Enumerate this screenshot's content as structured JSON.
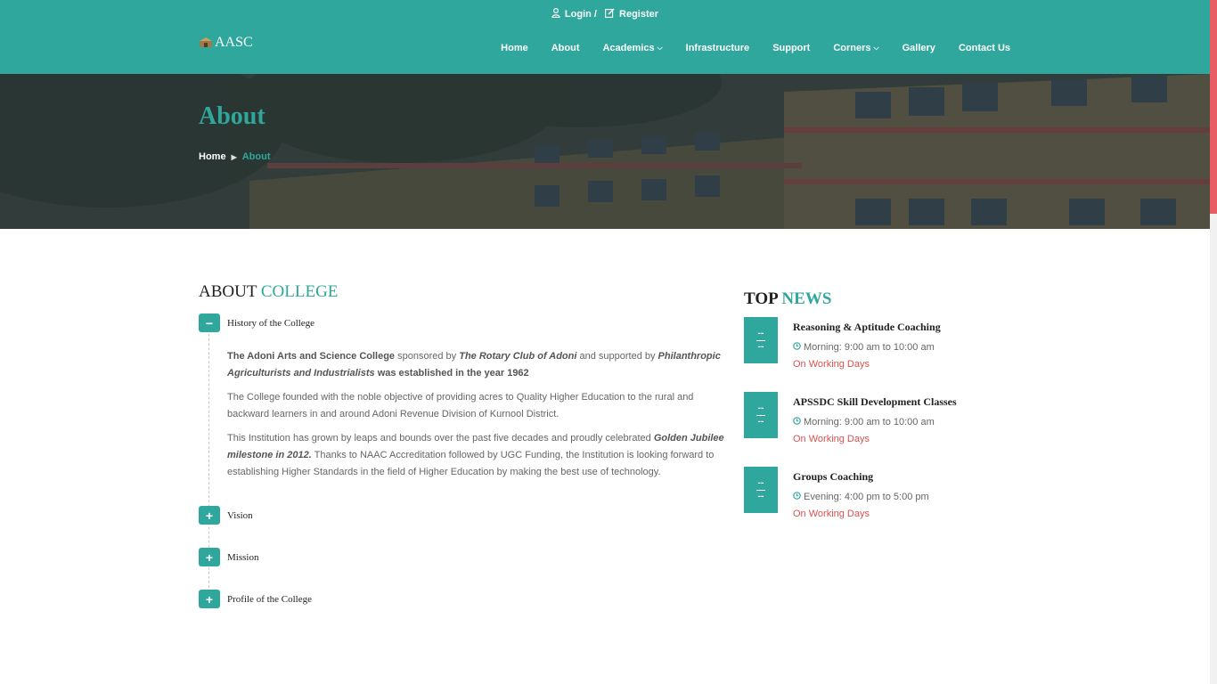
{
  "colors": {
    "brand": "#2fa79c",
    "accent_red": "#d9534f",
    "scroll_thumb": "#e85d64"
  },
  "topbar": {
    "login": "Login /",
    "register": "Register"
  },
  "logo": {
    "text": "AASC"
  },
  "nav": {
    "items": [
      {
        "label": "Home"
      },
      {
        "label": "About"
      },
      {
        "label": "Academics",
        "caret": "chevron-down-icon"
      },
      {
        "label": "Infrastructure"
      },
      {
        "label": "Support"
      },
      {
        "label": "Corners",
        "caret": "chevron-down-icon"
      },
      {
        "label": "Gallery"
      },
      {
        "label": "Contact Us"
      }
    ]
  },
  "banner": {
    "title": "About",
    "breadcrumb_home": "Home",
    "breadcrumb_current": "About"
  },
  "about": {
    "title_plain": "ABOUT",
    "title_accent": "COLLEGE",
    "accordion": [
      {
        "label": "History of the College",
        "state": "expanded",
        "toggle": "−"
      },
      {
        "label": "Vision",
        "state": "collapsed",
        "toggle": "+"
      },
      {
        "label": "Mission",
        "state": "collapsed",
        "toggle": "+"
      },
      {
        "label": "Profile of the College",
        "state": "collapsed",
        "toggle": "+"
      }
    ],
    "history": {
      "p1_a": "The Adoni Arts and Science College",
      "p1_b": " sponsored by ",
      "p1_c": "The Rotary Club of Adoni",
      "p1_d": " and supported by ",
      "p1_e": "Philanthropic Agriculturists and Industrialists",
      "p1_f": " was established in the year 1962",
      "p2": "The College founded with the noble objective of providing acres to Quality Higher Education to the rural and backward learners in and around Adoni Revenue Division of Kurnool District.",
      "p3_a": "This Institution has grown by leaps and bounds over the past five decades and proudly celebrated ",
      "p3_b": "Golden Jubilee milestone in 2012.",
      "p3_c": " Thanks to NAAC Accreditation followed by UGC Funding, the Institution is looking forward to establishing Higher Standards in the field of Higher Education by making the best use of technology."
    }
  },
  "news": {
    "title_plain": "TOP",
    "title_accent": "NEWS",
    "items": [
      {
        "date_top": "--",
        "date_bottom": "--",
        "headline": "Reasoning & Aptitude Coaching",
        "time": "Morning: 9:00 am to 10:00 am",
        "days": "On Working Days"
      },
      {
        "date_top": "--",
        "date_bottom": "--",
        "headline": "APSSDC Skill Development Classes",
        "time": "Morning: 9:00 am to 10:00 am",
        "days": "On Working Days"
      },
      {
        "date_top": "--",
        "date_bottom": "--",
        "headline": "Groups Coaching",
        "time": "Evening: 4:00 pm to 5:00 pm",
        "days": "On Working Days"
      }
    ]
  }
}
